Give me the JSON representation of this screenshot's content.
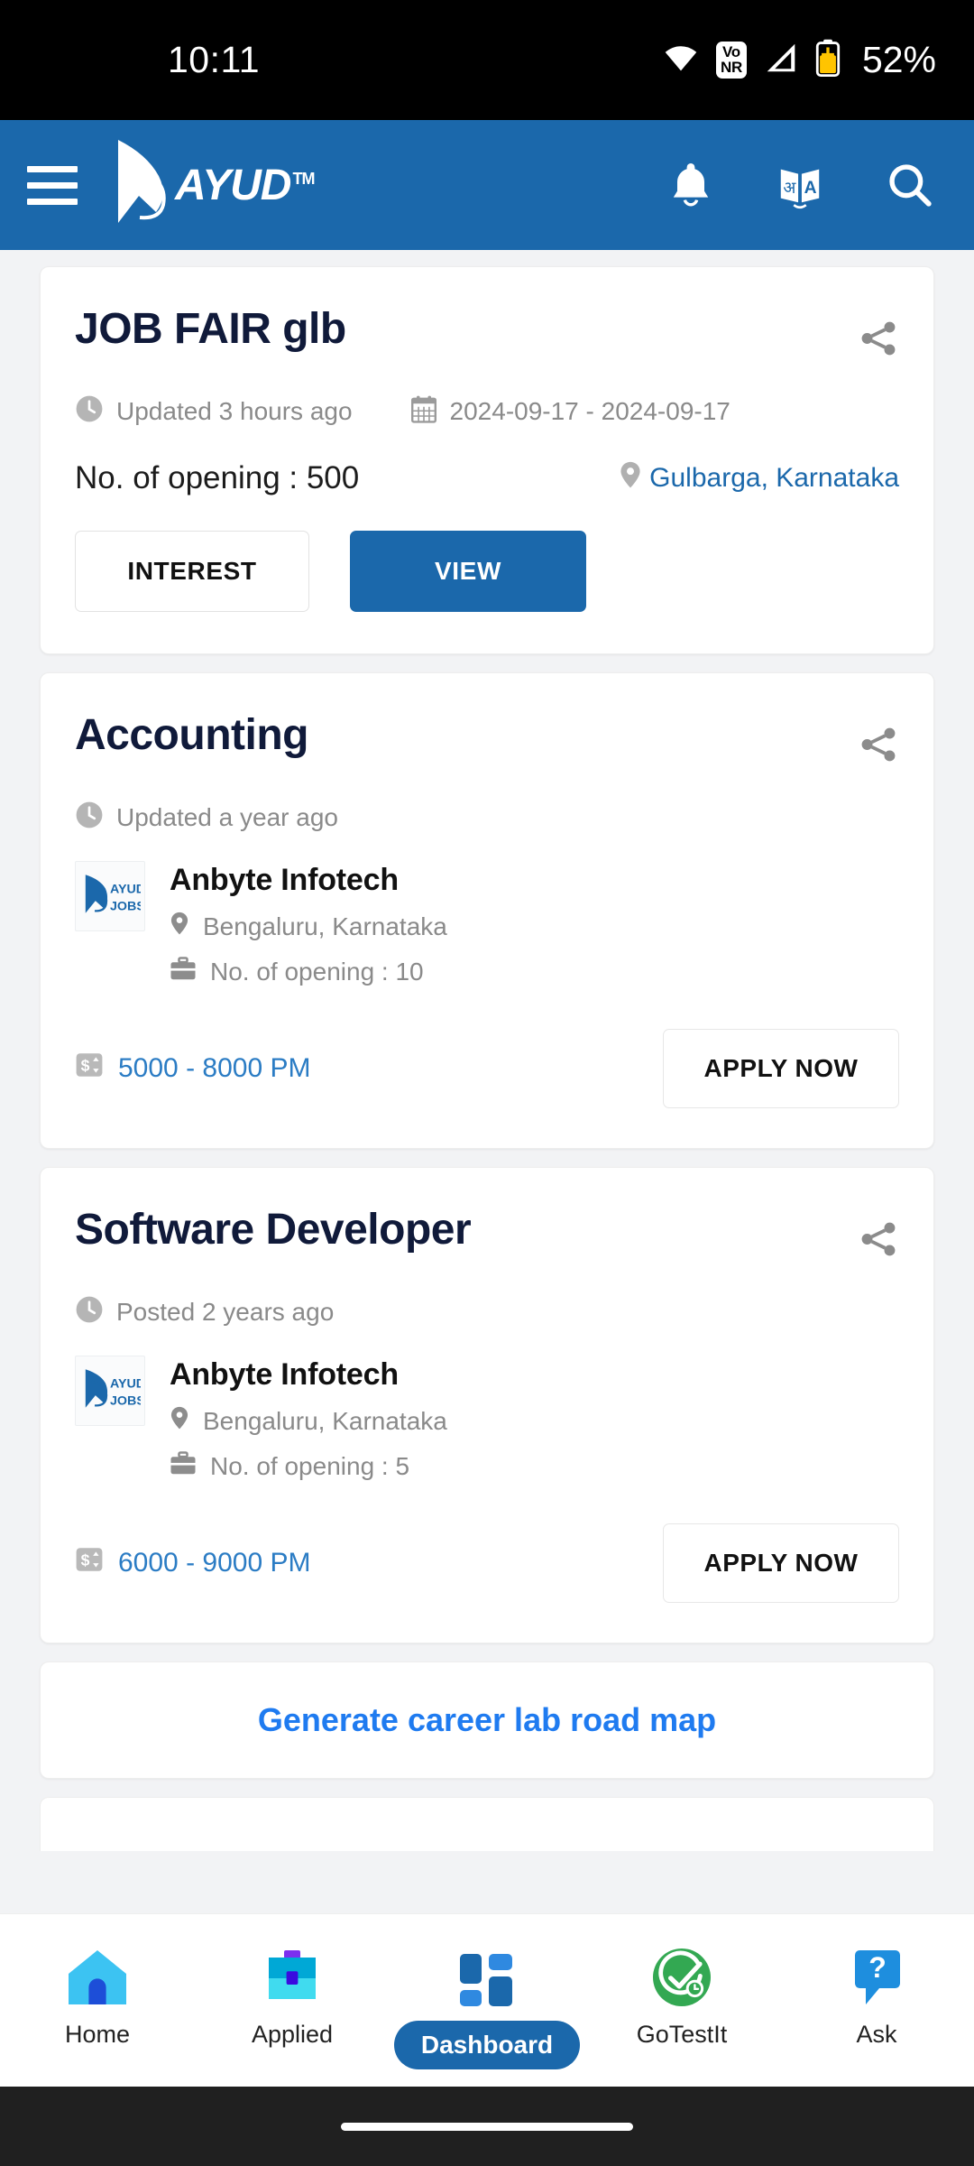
{
  "status_bar": {
    "time": "10:11",
    "battery_percent": "52%",
    "network_badge": "VoNR",
    "icons": [
      "wifi-icon",
      "vonr-badge",
      "signal-icon",
      "battery-icon"
    ]
  },
  "app_bar": {
    "menu_icon": "hamburger-menu-icon",
    "brand_name": "AYUD",
    "brand_tm": "TM",
    "actions": [
      {
        "name": "notifications-icon",
        "label": "Notifications"
      },
      {
        "name": "translate-icon",
        "label": "Translate"
      },
      {
        "name": "search-icon",
        "label": "Search"
      }
    ]
  },
  "colors": {
    "brand_blue": "#1b68ab",
    "link_blue": "#1f7bf0",
    "title_navy": "#101a3a",
    "muted_gray": "#8a8a8a",
    "page_bg": "#f2f3f5",
    "battery_yellow": "#ffc400",
    "gotestit_green": "#33a852"
  },
  "cards": [
    {
      "type": "job-fair",
      "title": "JOB FAIR glb",
      "updated": "Updated 3 hours ago",
      "date_range": "2024-09-17 - 2024-09-17",
      "openings": "No. of opening : 500",
      "location": "Gulbarga, Karnataka",
      "buttons": {
        "secondary": "INTEREST",
        "primary": "VIEW"
      }
    },
    {
      "type": "job",
      "title": "Accounting",
      "updated": "Updated a year ago",
      "company": "Anbyte Infotech",
      "company_logo_text_top": "AYUD",
      "company_logo_text_bottom": "JOBS",
      "location": "Bengaluru, Karnataka",
      "openings": "No. of opening : 10",
      "salary": "5000 - 8000 PM",
      "apply_label": "APPLY NOW"
    },
    {
      "type": "job",
      "title": "Software Developer",
      "updated": "Posted 2 years ago",
      "company": "Anbyte Infotech",
      "company_logo_text_top": "AYUD",
      "company_logo_text_bottom": "JOBS",
      "location": "Bengaluru, Karnataka",
      "openings": "No. of opening : 5",
      "salary": "6000 - 9000 PM",
      "apply_label": "APPLY NOW"
    }
  ],
  "career_link": {
    "label": "Generate career lab road map"
  },
  "bottom_nav": {
    "items": [
      {
        "label": "Home",
        "icon": "home-icon",
        "active": false
      },
      {
        "label": "Applied",
        "icon": "briefcase-icon",
        "active": false
      },
      {
        "label": "Dashboard",
        "icon": "grid-icon",
        "active": true
      },
      {
        "label": "GoTestIt",
        "icon": "check-timer-icon",
        "active": false
      },
      {
        "label": "Ask",
        "icon": "question-bubble-icon",
        "active": false
      }
    ]
  }
}
